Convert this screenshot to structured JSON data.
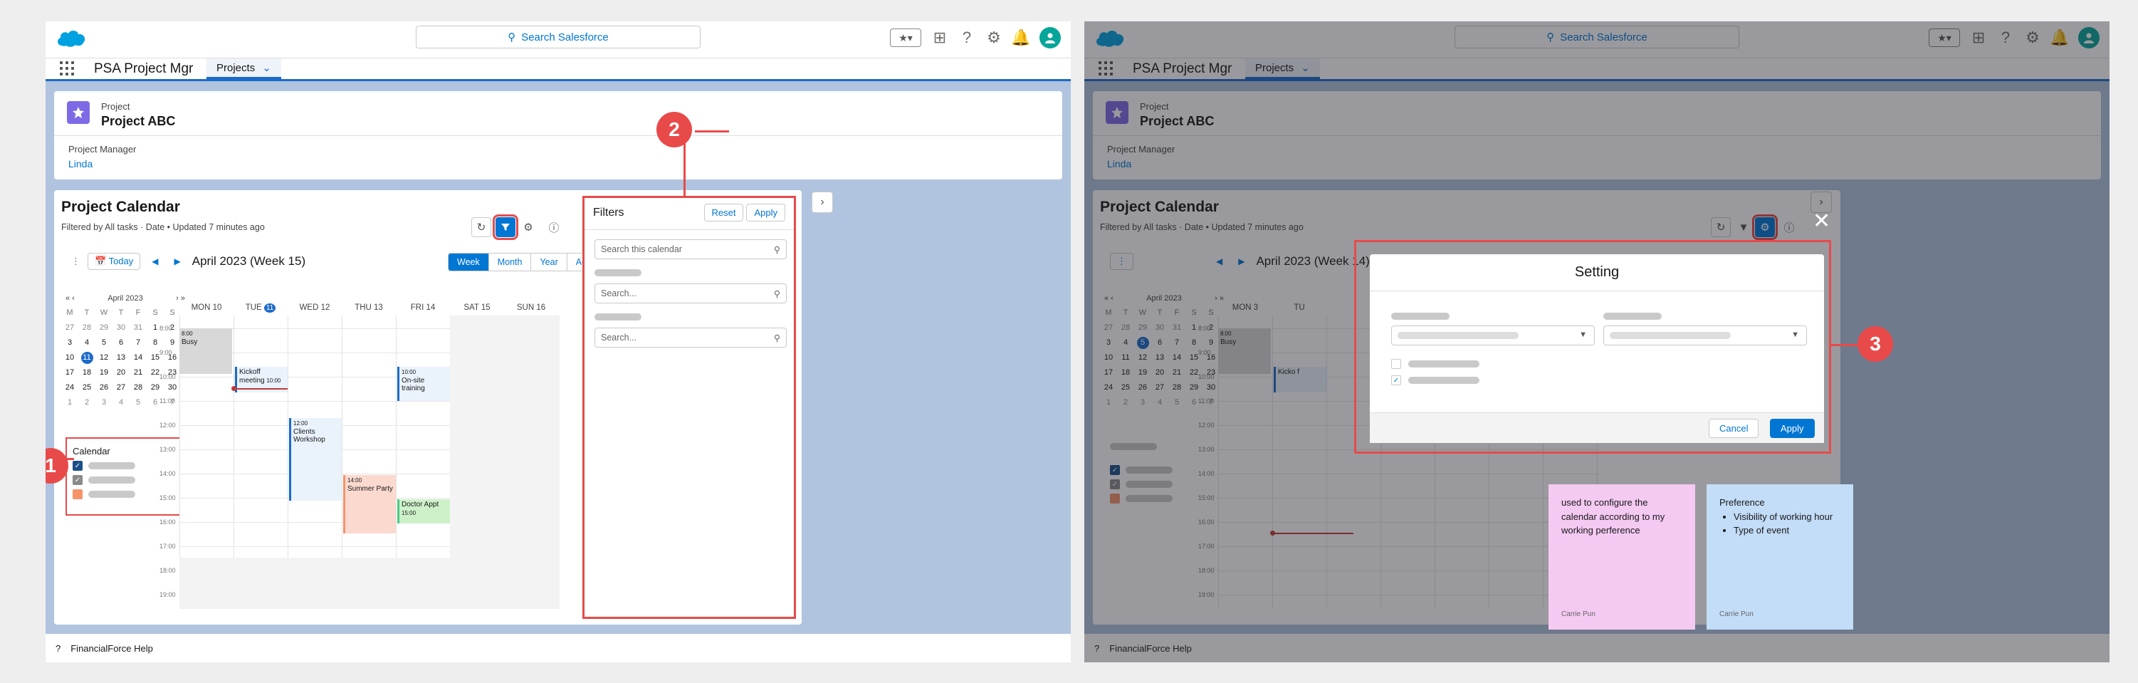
{
  "search_placeholder": "Search Salesforce",
  "app_name": "PSA Project Mgr",
  "nav_tab": "Projects",
  "record": {
    "type": "Project",
    "name": "Project ABC",
    "pm_label": "Project Manager",
    "pm_value": "Linda"
  },
  "calendar": {
    "title": "Project Calendar",
    "subtitle": "Filtered by All tasks · Date • Updated 7 minutes ago",
    "today": "Today",
    "week_title_left": "April 2023 (Week 15)",
    "week_title_right": "April 2023 (Week 14)",
    "views": [
      "Week",
      "Month",
      "Year",
      "Agenda"
    ],
    "mini_month": "April 2023",
    "mini_dow": [
      "M",
      "T",
      "W",
      "T",
      "F",
      "S",
      "S"
    ],
    "days_left": [
      "MON 10",
      "TUE",
      "WED 12",
      "THU 13",
      "FRI 14",
      "SAT 15",
      "SUN 16"
    ],
    "tue_num": "11",
    "days_right": [
      "MON 3",
      "TU"
    ],
    "times": [
      "8:00",
      "9:00",
      "10:00",
      "11:00",
      "12:00",
      "13:00",
      "14:00",
      "15:00",
      "16:00",
      "17:00",
      "18:00",
      "19:00"
    ],
    "calendar_label": "Calendar",
    "events": {
      "busy": "Busy",
      "busy_time": "8:00",
      "kickoff": "Kickoff meeting",
      "kickoff_time": "10:00",
      "onsite": "On-site training",
      "onsite_time": "10:00",
      "clients": "Clients Workshop",
      "clients_time": "12:00",
      "summer": "Summer Party",
      "summer_time": "14:00",
      "doctor": "Doctor Appt",
      "doctor_time": "15:00",
      "kick_right": "Kicko f"
    }
  },
  "filters": {
    "title": "Filters",
    "reset": "Reset",
    "apply": "Apply",
    "search_calendar": "Search this calendar",
    "search": "Search..."
  },
  "setting": {
    "title": "Setting",
    "cancel": "Cancel",
    "apply": "Apply"
  },
  "sticky1": {
    "text": "used to configure the calendar according to my working perference",
    "author": "Carrie Pun"
  },
  "sticky2": {
    "title": "Preference",
    "items": [
      "Visibility of working hour",
      "Type of event"
    ],
    "author": "Carrie Pun"
  },
  "footer": "FinancialForce Help",
  "badges": [
    "1",
    "2",
    "3"
  ],
  "colors": {
    "accent": "#0176d3",
    "annotation": "#e84a4a",
    "brand_cloud": "#00a1e0",
    "sticky_pink": "#f4c9f2",
    "sticky_blue": "#c3dcf7"
  }
}
